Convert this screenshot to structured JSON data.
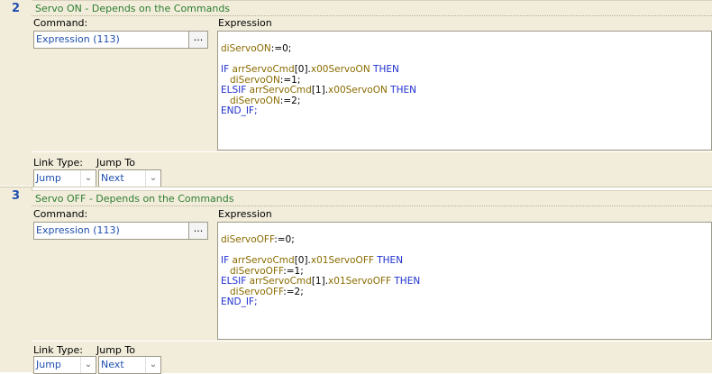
{
  "steps": [
    {
      "number": "2",
      "title": "Servo ON - Depends on the Commands",
      "command_label": "Command:",
      "expression_label": "Expression",
      "command_value": "Expression (113)",
      "browse_label": "...",
      "code": {
        "l1a": "diServoON",
        "l1b": ":=0;",
        "l3a": "IF ",
        "l3b": "arrServoCmd",
        "l3c": "[0].",
        "l3d": "x00ServoON",
        "l3e": " THEN",
        "l4a": "diServoON",
        "l4b": ":=1;",
        "l5a": "ELSIF ",
        "l5b": "arrServoCmd",
        "l5c": "[1].",
        "l5d": "x00ServoON",
        "l5e": " THEN",
        "l6a": "diServoON",
        "l6b": ":=2;",
        "l7": "END_IF;"
      },
      "link_type_label": "Link Type:",
      "jump_to_label": "Jump To",
      "link_type_value": "Jump",
      "jump_to_value": "Next"
    },
    {
      "number": "3",
      "title": "Servo OFF - Depends on the Commands",
      "command_label": "Command:",
      "expression_label": "Expression",
      "command_value": "Expression (113)",
      "browse_label": "...",
      "code": {
        "l1a": "diServoOFF",
        "l1b": ":=0;",
        "l3a": "IF ",
        "l3b": "arrServoCmd",
        "l3c": "[0].",
        "l3d": "x01ServoOFF",
        "l3e": " THEN",
        "l4a": "diServoOFF",
        "l4b": ":=1;",
        "l5a": "ELSIF ",
        "l5b": "arrServoCmd",
        "l5c": "[1].",
        "l5d": "x01ServoOFF",
        "l5e": " THEN",
        "l6a": "diServoOFF",
        "l6b": ":=2;",
        "l7": "END_IF;"
      },
      "link_type_label": "Link Type:",
      "jump_to_label": "Jump To",
      "link_type_value": "Jump",
      "jump_to_value": "Next"
    }
  ],
  "icons": {
    "dropdown_arrow": "chevron-down-icon"
  },
  "colors": {
    "panel": "#f2eddb",
    "title": "#2e7d32",
    "keyword": "#1f2fcf",
    "variable": "#8a6b00",
    "step_number": "#1f4fae"
  }
}
